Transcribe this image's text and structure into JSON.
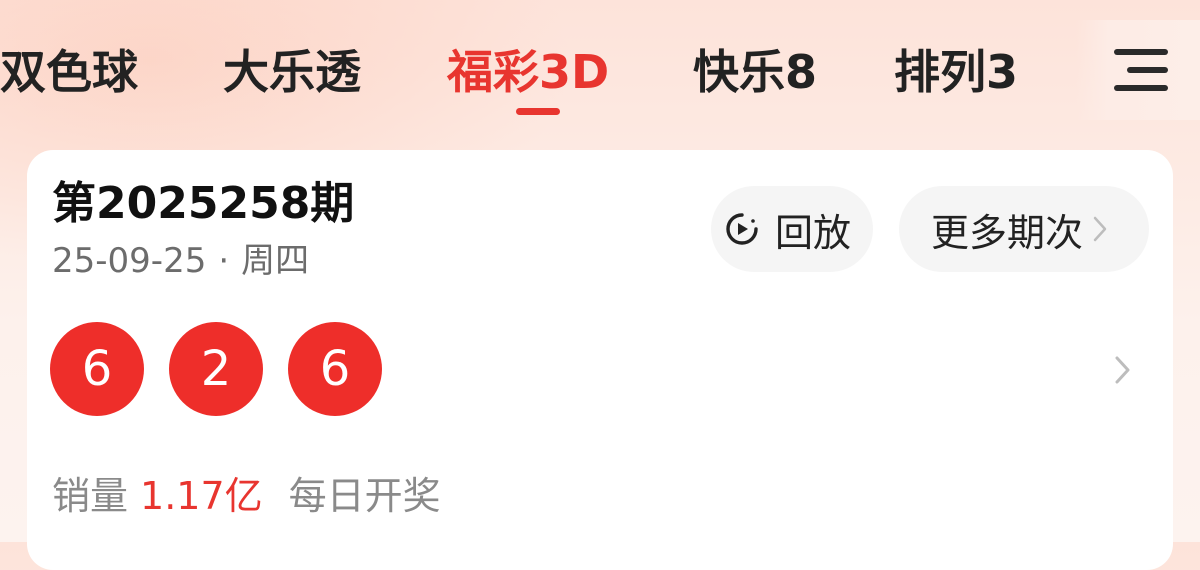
{
  "tabs": [
    {
      "label": "双色球"
    },
    {
      "label": "大乐透"
    },
    {
      "label": "福彩3D"
    },
    {
      "label": "快乐8"
    },
    {
      "label": "排列3"
    }
  ],
  "active_tab": "福彩3D",
  "colors": {
    "accent": "#e8352f",
    "ball": "#ee2e2a"
  },
  "draw": {
    "issue": "第2025258期",
    "date": "25-09-25",
    "separator": "·",
    "weekday": "周四",
    "numbers": [
      "6",
      "2",
      "6"
    ],
    "sales_label": "销量",
    "sales_value": "1.17亿",
    "frequency": "每日开奖"
  },
  "actions": {
    "replay_label": "回放",
    "replay_icon": "play-circle-icon",
    "more_label": "更多期次"
  },
  "icons": {
    "menu": "menu-icon",
    "chevron": "chevron-right-icon"
  }
}
